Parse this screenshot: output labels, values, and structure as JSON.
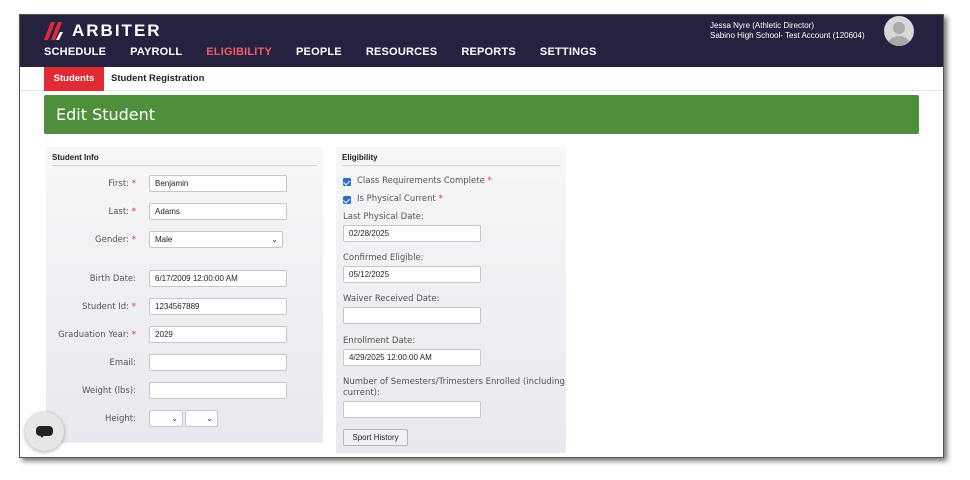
{
  "brand": {
    "name": "ARBITER",
    "logo_color": "#e02b35"
  },
  "topbar": {
    "background": "#25223f",
    "nav": [
      "SCHEDULE",
      "PAYROLL",
      "ELIGIBILITY",
      "PEOPLE",
      "RESOURCES",
      "REPORTS",
      "SETTINGS"
    ],
    "active_nav": "ELIGIBILITY",
    "user_name": "Jessa Nyre (Athletic Director)",
    "account": "Sabino High School- Test Account (120604)"
  },
  "subnav": {
    "tabs": [
      "Students",
      "Student Registration"
    ],
    "active": "Students"
  },
  "page": {
    "title": "Edit Student",
    "header_color": "#4f8f3b"
  },
  "student_info": {
    "title": "Student Info",
    "first_label": "First:",
    "first_value": "Benjamin",
    "last_label": "Last:",
    "last_value": "Adams",
    "gender_label": "Gender:",
    "gender_value": "Male",
    "birth_label": "Birth Date:",
    "birth_value": "6/17/2009 12:00:00 AM",
    "student_id_label": "Student Id:",
    "student_id_value": "1234567889",
    "grad_label": "Graduation Year:",
    "grad_value": "2029",
    "email_label": "Email:",
    "email_value": "",
    "weight_label": "Weight (lbs):",
    "weight_value": "",
    "height_label": "Height:",
    "height_feet": "",
    "height_inches": ""
  },
  "eligibility": {
    "title": "Eligibility",
    "class_req_label": "Class Requirements Complete",
    "class_req_checked": true,
    "physical_label": "Is Physical Current",
    "physical_checked": true,
    "last_physical_label": "Last Physical Date:",
    "last_physical_value": "02/28/2025",
    "confirmed_label": "Confirmed Eligible:",
    "confirmed_value": "05/12/2025",
    "waiver_label": "Waiver Received Date:",
    "waiver_value": "",
    "enrollment_label": "Enrollment Date:",
    "enrollment_value": "4/29/2025 12:00:00 AM",
    "semesters_label_1": "Number of Semesters/Trimesters Enrolled (including",
    "semesters_label_2": "current):",
    "semesters_value": "",
    "sport_history_button": "Sport History"
  },
  "required_mark": "*",
  "icons": {
    "chat": "chat-bubble-icon",
    "avatar": "user-avatar-icon",
    "chevron": "chevron-down-icon"
  }
}
